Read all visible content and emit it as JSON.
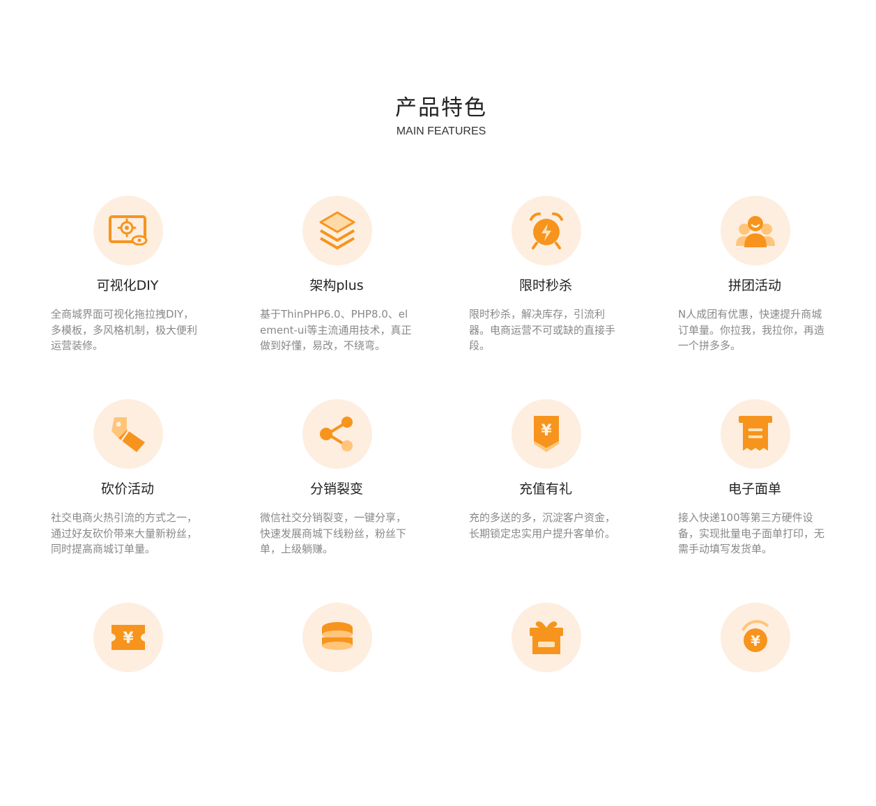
{
  "header": {
    "title": "产品特色",
    "subtitle": "MAIN FEATURES"
  },
  "colors": {
    "accent": "#f7941d",
    "accent_light": "#ffc57a",
    "icon_bg": "#fdeee0"
  },
  "features": [
    {
      "icon": "monitor-gear-icon",
      "title": "可视化DIY",
      "desc": "全商城界面可视化拖拉拽DIY，多模板，多风格机制，极大便利运营装修。"
    },
    {
      "icon": "layers-icon",
      "title": "架构plus",
      "desc": "基于ThinPHP6.0、PHP8.0、element-ui等主流通用技术，真正做到好懂，易改，不绕弯。"
    },
    {
      "icon": "alarm-clock-icon",
      "title": "限时秒杀",
      "desc": "限时秒杀，解决库存，引流利器。电商运营不可或缺的直接手段。"
    },
    {
      "icon": "group-users-icon",
      "title": "拼团活动",
      "desc": "N人成团有优惠，快速提升商城订单量。你拉我，我拉你，再造一个拼多多。"
    },
    {
      "icon": "price-tag-icon",
      "title": "砍价活动",
      "desc": "社交电商火热引流的方式之一，通过好友砍价带来大量新粉丝，同时提高商城订单量。"
    },
    {
      "icon": "share-icon",
      "title": "分销裂变",
      "desc": "微信社交分销裂变，一键分享，快速发展商城下线粉丝，粉丝下单，上级躺赚。"
    },
    {
      "icon": "yuan-badge-icon",
      "title": "充值有礼",
      "desc": "充的多送的多，沉淀客户资金，长期锁定忠实用户提升客单价。"
    },
    {
      "icon": "receipt-icon",
      "title": "电子面单",
      "desc": "接入快递100等第三方硬件设备，实现批量电子面单打印，无需手动填写发货单。"
    },
    {
      "icon": "yuan-coupon-icon",
      "title": "",
      "desc": ""
    },
    {
      "icon": "coin-stack-icon",
      "title": "",
      "desc": ""
    },
    {
      "icon": "gift-box-icon",
      "title": "",
      "desc": ""
    },
    {
      "icon": "yuan-coin-icon",
      "title": "",
      "desc": ""
    }
  ]
}
